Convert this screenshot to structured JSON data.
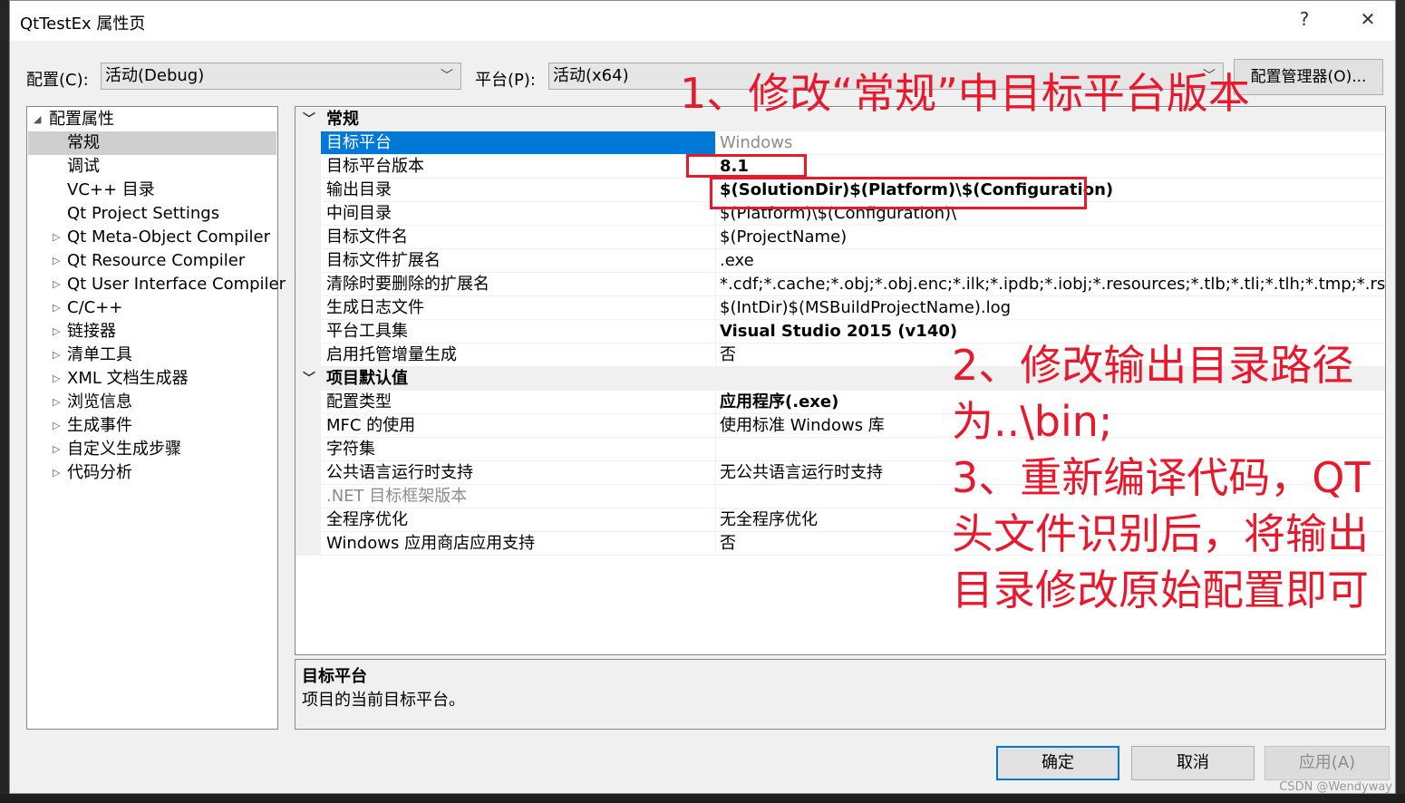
{
  "window": {
    "title": "QtTestEx 属性页",
    "help": "?",
    "close": "✕"
  },
  "toolbar": {
    "config_label": "配置(C):",
    "config_value": "活动(Debug)",
    "platform_label": "平台(P):",
    "platform_value": "活动(x64)",
    "config_manager": "配置管理器(O)..."
  },
  "tree": {
    "root": "配置属性",
    "items": [
      {
        "label": "常规"
      },
      {
        "label": "调试"
      },
      {
        "label": "VC++ 目录"
      },
      {
        "label": "Qt Project Settings"
      },
      {
        "label": "Qt Meta-Object Compiler"
      },
      {
        "label": "Qt Resource Compiler"
      },
      {
        "label": "Qt User Interface Compiler"
      },
      {
        "label": "C/C++"
      },
      {
        "label": "链接器"
      },
      {
        "label": "清单工具"
      },
      {
        "label": "XML 文档生成器"
      },
      {
        "label": "浏览信息"
      },
      {
        "label": "生成事件"
      },
      {
        "label": "自定义生成步骤"
      },
      {
        "label": "代码分析"
      }
    ]
  },
  "grid": {
    "cat_general": "常规",
    "cat_defaults": "项目默认值",
    "general": [
      {
        "name": "目标平台",
        "value": "Windows"
      },
      {
        "name": "目标平台版本",
        "value": "8.1"
      },
      {
        "name": "输出目录",
        "value": "$(SolutionDir)$(Platform)\\$(Configuration)"
      },
      {
        "name": "中间目录",
        "value": "$(Platform)\\$(Configuration)\\"
      },
      {
        "name": "目标文件名",
        "value": "$(ProjectName)"
      },
      {
        "name": "目标文件扩展名",
        "value": ".exe"
      },
      {
        "name": "清除时要删除的扩展名",
        "value": "*.cdf;*.cache;*.obj;*.obj.enc;*.ilk;*.ipdb;*.iobj;*.resources;*.tlb;*.tli;*.tlh;*.tmp;*.rsp;*.pgc;*"
      },
      {
        "name": "生成日志文件",
        "value": "$(IntDir)$(MSBuildProjectName).log"
      },
      {
        "name": "平台工具集",
        "value": "Visual Studio 2015 (v140)"
      },
      {
        "name": "启用托管增量生成",
        "value": "否"
      }
    ],
    "defaults": [
      {
        "name": "配置类型",
        "value": "应用程序(.exe)"
      },
      {
        "name": "MFC 的使用",
        "value": "使用标准 Windows 库"
      },
      {
        "name": "字符集",
        "value": ""
      },
      {
        "name": "公共语言运行时支持",
        "value": "无公共语言运行时支持"
      },
      {
        "name": ".NET 目标框架版本",
        "value": ""
      },
      {
        "name": "全程序优化",
        "value": "无全程序优化"
      },
      {
        "name": "Windows 应用商店应用支持",
        "value": "否"
      }
    ]
  },
  "description": {
    "title": "目标平台",
    "text": "项目的当前目标平台。"
  },
  "buttons": {
    "ok": "确定",
    "cancel": "取消",
    "apply": "应用(A)"
  },
  "annotations": {
    "line1": "1、修改“常规”中目标平台版本",
    "line2": "2、修改输出目录路径",
    "line3": "为..\\bin;",
    "line4": "3、重新编译代码，QT",
    "line5": "头文件识别后，将输出",
    "line6": "目录修改原始配置即可",
    "color": "#e8192c"
  },
  "watermark": "CSDN @Wendyway"
}
